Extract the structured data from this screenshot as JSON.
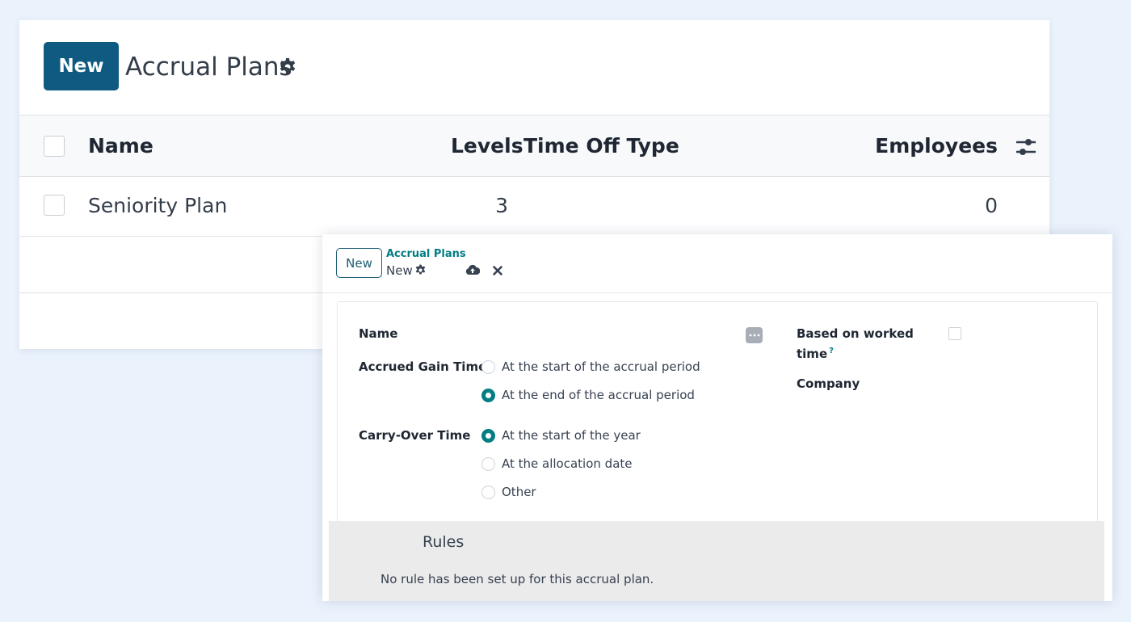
{
  "list_view": {
    "new_button": "New",
    "title": "Accrual Plans",
    "columns": {
      "name": "Name",
      "levels": "Levels",
      "time_off_type": "Time Off Type",
      "employees": "Employees"
    },
    "rows": [
      {
        "name": "Seniority Plan",
        "levels": "3",
        "time_off_type": "",
        "employees": "0"
      }
    ]
  },
  "form_view": {
    "new_button": "New",
    "breadcrumb": {
      "parent": "Accrual Plans",
      "current": "New"
    },
    "fields": {
      "name_label": "Name",
      "accrued_gain_time": {
        "label": "Accrued Gain Time",
        "options": [
          "At the start of the accrual period",
          "At the end of the accrual period"
        ],
        "selected_index": 1
      },
      "carry_over_time": {
        "label": "Carry-Over Time",
        "options": [
          "At the start of the year",
          "At the allocation date",
          "Other"
        ],
        "selected_index": 0
      },
      "based_on_worked_time": {
        "label_line1": "Based on worked",
        "label_line2": "time",
        "help": "?",
        "checked": false
      },
      "company_label": "Company"
    },
    "rules": {
      "title": "Rules",
      "empty_message": "No rule has been set up for this accrual plan."
    }
  },
  "colors": {
    "primary": "#0e5a80",
    "accent": "#017e84",
    "background": "#eaf2fc"
  }
}
